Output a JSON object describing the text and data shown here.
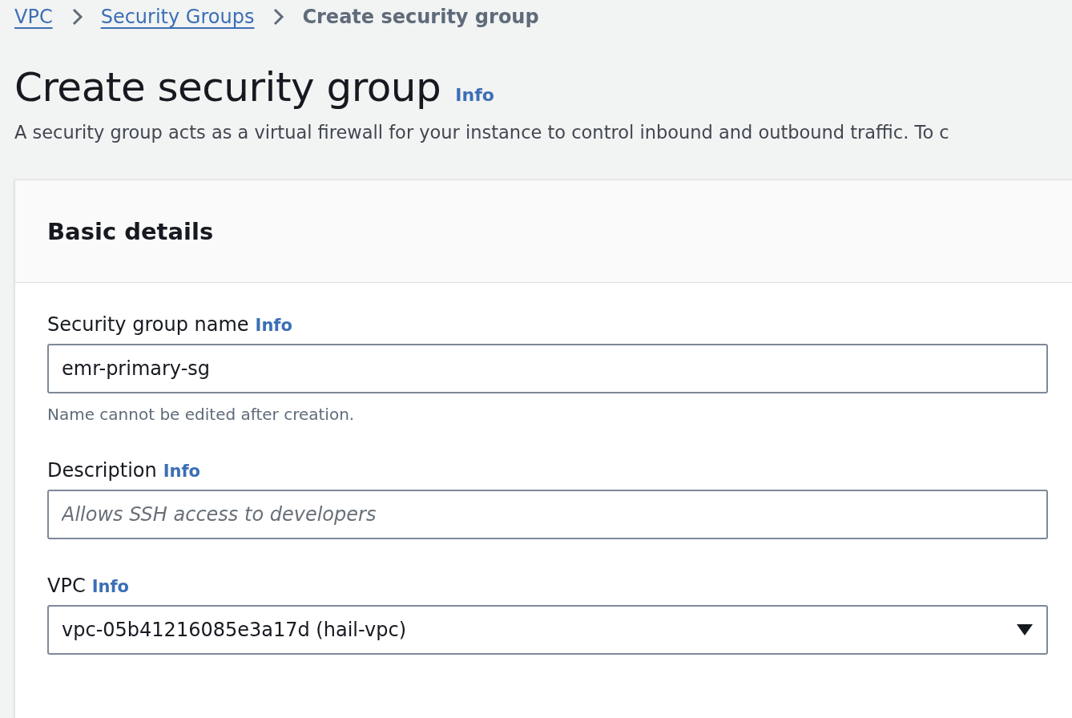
{
  "breadcrumbs": [
    {
      "label": "VPC",
      "kind": "link"
    },
    {
      "label": "Security Groups",
      "kind": "link"
    },
    {
      "label": "Create security group",
      "kind": "current"
    }
  ],
  "page": {
    "title": "Create security group",
    "info": "Info",
    "description": "A security group acts as a virtual firewall for your instance to control inbound and outbound traffic. To c"
  },
  "panel": {
    "title": "Basic details",
    "fields": [
      {
        "kind": "text",
        "label": "Security group name",
        "info": "Info",
        "value": "emr-primary-sg",
        "hint": "Name cannot be edited after creation."
      },
      {
        "kind": "text",
        "label": "Description",
        "info": "Info",
        "placeholder": "Allows SSH access to developers"
      },
      {
        "kind": "select",
        "label": "VPC",
        "info": "Info",
        "value": "vpc-05b41216085e3a17d (hail-vpc)"
      }
    ]
  }
}
